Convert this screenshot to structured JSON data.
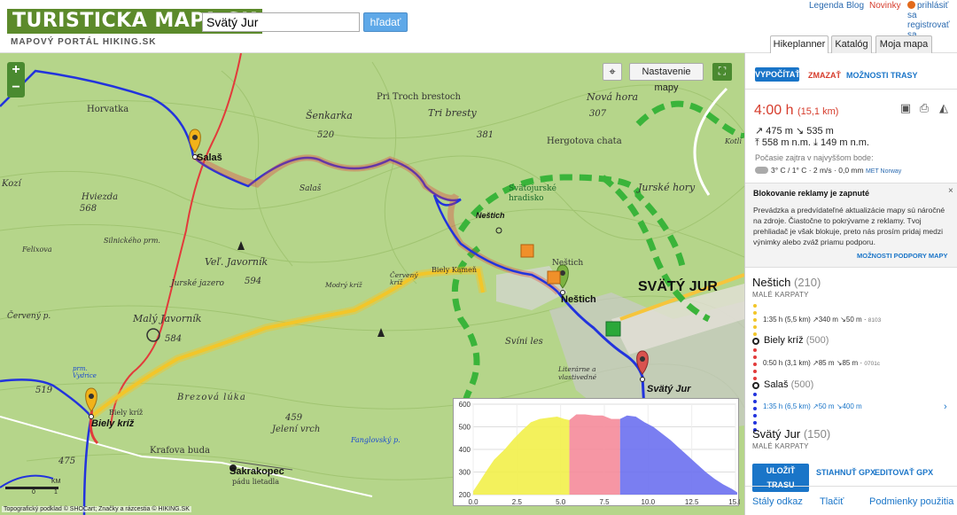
{
  "header": {
    "logo": "TURISTICKA MAPA.SK",
    "logo_sub": "MAPOVÝ PORTÁL HIKING.SK",
    "search_value": "Svätý Jur",
    "search_button": "hľadať",
    "links": {
      "legend": "Legenda",
      "blog": "Blog",
      "news": "Novinky"
    },
    "login": "prihlásiť sa",
    "register": "registrovať sa",
    "tabs": [
      "Hikeplanner",
      "Katalóg",
      "Moja mapa"
    ]
  },
  "map": {
    "settings_button": "Nastavenie mapy",
    "locate_icon": "crosshair-icon",
    "fullscreen_icon": "fullscreen-icon",
    "zoom_in": "+",
    "zoom_out": "−",
    "scale_label": "KM",
    "scale_ticks": [
      "0",
      "1"
    ],
    "attribution": "Topografický podklad © SHOCart; Značky a rázcestia © HIKING.SK",
    "labels": {
      "salas_pin": "Salaš",
      "salas_ital": "Salaš",
      "horvatka": "Horvatka",
      "hviezda": "Hviezda",
      "hviezda_ele": "568",
      "kozi": "Kozí",
      "felixova": "Felixova",
      "silnickeho": "Silnického prm.",
      "cerveny_p": "Červený p.",
      "maly_javornik": "Malý Javorník",
      "maly_javornik_ele": "584",
      "vel_javornik": "Veľ. Javorník",
      "vel_javornik_ele": "594",
      "jurske_jazero": "Jurské jazero",
      "pri_troch_brestoch": "Pri Troch brestoch",
      "tri_bresty": "Tri bresty",
      "tri_bresty_ele": "381",
      "senkarka": "Šenkarka",
      "senkarka_ele": "520",
      "hergotova": "Hergotova chata",
      "nova_hora": "Nová hora",
      "nova_hora_ele": "307",
      "jurske_hory": "Jurské hory",
      "svatojurske": "Svätojurské hradisko",
      "nestich": "Neštich",
      "nestich_pin": "Neštich",
      "nestich_small": "Neštich",
      "svaty_jur_big": "SVÄTÝ JUR",
      "svaty_jur_pin": "Svätý Jur",
      "biely_kamen": "Biely Kameň",
      "modry_kriz": "Modrý kríž",
      "cerveny_kriz": "Červený kríž",
      "svini_les": "Svíni les",
      "literarne": "Literárne a vlastivedné",
      "biely_kriz_small": "Biely kríž",
      "biely_kriz_pin": "Biely kríž",
      "ele_519": "519",
      "prm_vydrica": "prm. Vydrice",
      "brezova_luka": "Brezová lúka",
      "ele_459": "459",
      "jeleni_vrch": "Jelení vrch",
      "krafova_buda": "Krafova buda",
      "sakrakopec": "Sakrakopec",
      "padu_lietadla": "pádu lietadla",
      "ele_475": "475",
      "fanglovsky": "Fanglovský p.",
      "kotli": "Kotlí"
    },
    "colors": {
      "route_yellow": "#f2c62a",
      "route_red": "#e23b3b",
      "route_blue": "#2233dd",
      "forest": "#b5d58a",
      "trail_green": "#3ab43a"
    }
  },
  "profile": {
    "chart_data": {
      "type": "area",
      "xlabel": "",
      "ylabel": "",
      "xlim": [
        0,
        15
      ],
      "ylim": [
        200,
        600
      ],
      "x_ticks": [
        "0.0",
        "2.5",
        "5.0",
        "7.5",
        "10.0",
        "12.5",
        "15.0"
      ],
      "y_ticks": [
        "200",
        "300",
        "400",
        "500",
        "600"
      ],
      "series": [
        {
          "color": "#f2ef4a",
          "x": [
            0,
            0.3,
            0.8,
            1.2,
            1.8,
            2.3,
            2.8,
            3.3,
            3.8,
            4.3,
            4.8,
            5.2,
            5.5
          ],
          "values": [
            215,
            250,
            310,
            355,
            400,
            445,
            485,
            520,
            535,
            540,
            545,
            535,
            530
          ]
        },
        {
          "color": "#f58b9a",
          "x": [
            5.5,
            5.9,
            6.4,
            6.9,
            7.4,
            7.9,
            8.4
          ],
          "values": [
            530,
            555,
            555,
            550,
            550,
            535,
            535
          ]
        },
        {
          "color": "#6b70f0",
          "x": [
            8.4,
            8.8,
            9.3,
            9.8,
            10.3,
            10.8,
            11.3,
            11.8,
            12.3,
            12.8,
            13.3,
            13.8,
            14.3,
            14.8,
            15.1
          ],
          "values": [
            535,
            550,
            545,
            520,
            500,
            470,
            440,
            405,
            370,
            335,
            300,
            270,
            245,
            225,
            210
          ]
        }
      ]
    }
  },
  "sidebar": {
    "buttons": {
      "compute": "VYPOČÍTAŤ",
      "delete": "ZMAZAŤ",
      "options": "MOŽNOSTI TRASY"
    },
    "duration": "4:00 h",
    "distance": "(15,1 km)",
    "icons": [
      "save-icon",
      "print-icon",
      "elevation-icon"
    ],
    "stats": {
      "ascent": "475 m",
      "descent": "535 m",
      "max": "558 m n.m.",
      "min": "149 m n.m."
    },
    "weather_label": "Počasie zajtra v najvyššom bode:",
    "weather": "3° C / 1° C · 2 m/s · 0,0 mm",
    "weather_source": "MET Norway",
    "adblock": {
      "title": "Blokovanie reklamy je zapnuté",
      "text": "Prevádzka a predvídateľné aktualizácie mapy sú náročné na zdroje. Čiastočne to pokrývame z reklamy. Tvoj prehliadač je však blokuje, preto nás prosím pridaj medzi výnimky alebo zváž priamu podporu.",
      "link": "MOŽNOSTI PODPORY MAPY",
      "close": "×"
    },
    "waypoints": [
      {
        "name": "Neštich",
        "elevation": "(210)",
        "region": "MALÉ KARPATY"
      },
      {
        "name": "Biely kríž",
        "elevation": "(500)"
      },
      {
        "name": "Salaš",
        "elevation": "(500)"
      },
      {
        "name": "Svätý Jur",
        "elevation": "(150)",
        "region": "MALÉ KARPATY"
      }
    ],
    "segments": [
      {
        "text": "1:35 h (5,5 km) ↗340 m ↘50 m",
        "code": "8103",
        "color": "#f2c62a"
      },
      {
        "text": "0:50 h (3,1 km) ↗85 m ↘85 m",
        "code": "0701c",
        "color": "#e23b3b"
      },
      {
        "text": "1:35 h (6,5 km) ↗50 m ↘400 m",
        "code": "",
        "color": "#2233dd"
      }
    ],
    "bottom_buttons": {
      "save": "ULOŽIŤ TRASU",
      "gpx": "STIAHNUŤ GPX",
      "edit_gpx": "EDITOVAŤ GPX"
    },
    "footer": [
      "Stály odkaz",
      "Tlačiť",
      "Podmienky použitia"
    ]
  }
}
